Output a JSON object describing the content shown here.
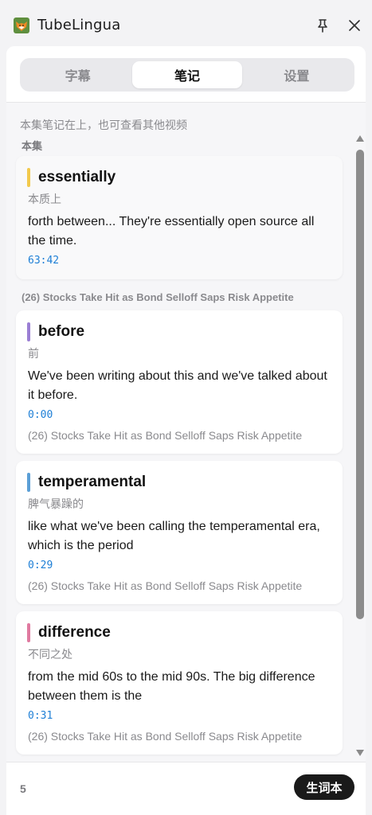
{
  "window": {
    "title": "TubeLingua"
  },
  "tabs": [
    {
      "label": "字幕",
      "active": false
    },
    {
      "label": "笔记",
      "active": true
    },
    {
      "label": "设置",
      "active": false
    }
  ],
  "notes": {
    "hint": "本集笔记在上，也可查看其他视频",
    "current_section_label": "本集",
    "other_group_label": "(26) Stocks Take Hit as Bond Selloff Saps Risk Appetite",
    "cards": [
      {
        "word": "essentially",
        "meaning": "本质上",
        "sentence": "forth between... They're essentially open source all the time.",
        "time": "63:42",
        "source": "",
        "accent": "#f2c94c"
      },
      {
        "word": "before",
        "meaning": "前",
        "sentence": "We've been writing about this and we've talked about it before.",
        "time": "0:00",
        "source": "(26) Stocks Take Hit as Bond Selloff Saps Risk Appetite",
        "accent": "#9b7fd4"
      },
      {
        "word": "temperamental",
        "meaning": "脾气暴躁的",
        "sentence": "like what we've been calling the temperamental era, which is the period",
        "time": "0:29",
        "source": "(26) Stocks Take Hit as Bond Selloff Saps Risk Appetite",
        "accent": "#5b9fd6"
      },
      {
        "word": "difference",
        "meaning": "不同之处",
        "sentence": "from the mid 60s to the mid 90s. The big difference between them is the",
        "time": "0:31",
        "source": "(26) Stocks Take Hit as Bond Selloff Saps Risk Appetite",
        "accent": "#e07aa0"
      }
    ]
  },
  "footer": {
    "count": "5",
    "vocab_button": "生词本"
  },
  "icons": {
    "app": "fox-app-icon",
    "pin": "pin-icon",
    "close": "close-icon"
  }
}
